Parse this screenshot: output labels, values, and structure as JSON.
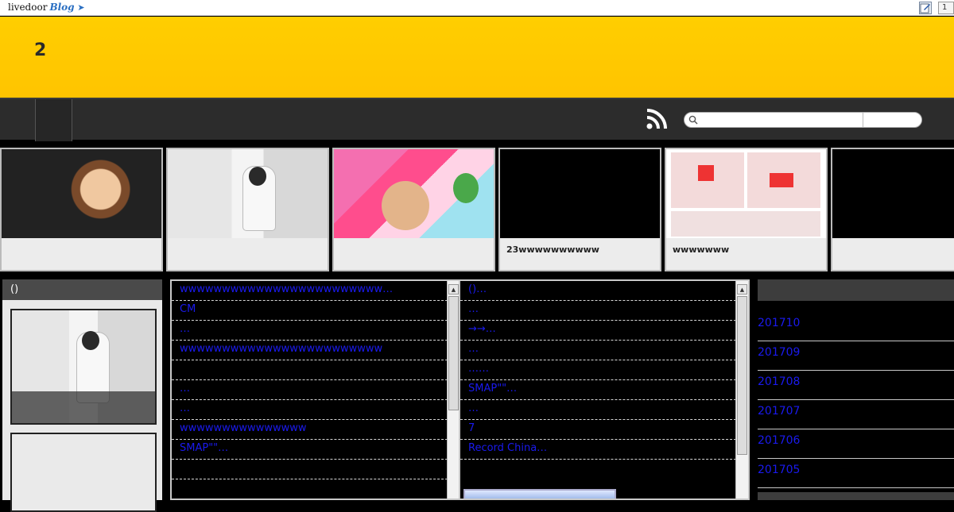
{
  "topbar": {
    "logo_text": "livedoor",
    "logo_blog": "Blog",
    "extra_label": "1"
  },
  "header": {
    "title": "2"
  },
  "nav": {
    "search_placeholder": ""
  },
  "thumbnails": [
    {
      "caption": ""
    },
    {
      "caption": ""
    },
    {
      "caption": ""
    },
    {
      "caption": "23wwwwwwwwww"
    },
    {
      "caption": "wwwwwww"
    },
    {
      "caption": ""
    }
  ],
  "left_sidebar": {
    "heading": "()"
  },
  "center_left_list": [
    "wwwwwwwwwwwwwwwwwwwwwwww…",
    "CM",
    "…",
    "wwwwwwwwwwwwwwwwwwwwwwww",
    "",
    "…",
    "…",
    "wwwwwwwwwwwwwww",
    "SMAP\"\"…",
    "",
    ""
  ],
  "center_right_list": [
    "()…",
    "…",
    "→→…",
    "…",
    "……",
    "SMAP\"\"…",
    "…",
    "7",
    "Record China…"
  ],
  "archive": {
    "months": [
      "201710",
      "201709",
      "201708",
      "201707",
      "201706",
      "201705"
    ]
  },
  "colors": {
    "header_yellow": "#ffc800",
    "nav_dark": "#2c2c2c",
    "link_blue": "#1a1aee"
  }
}
